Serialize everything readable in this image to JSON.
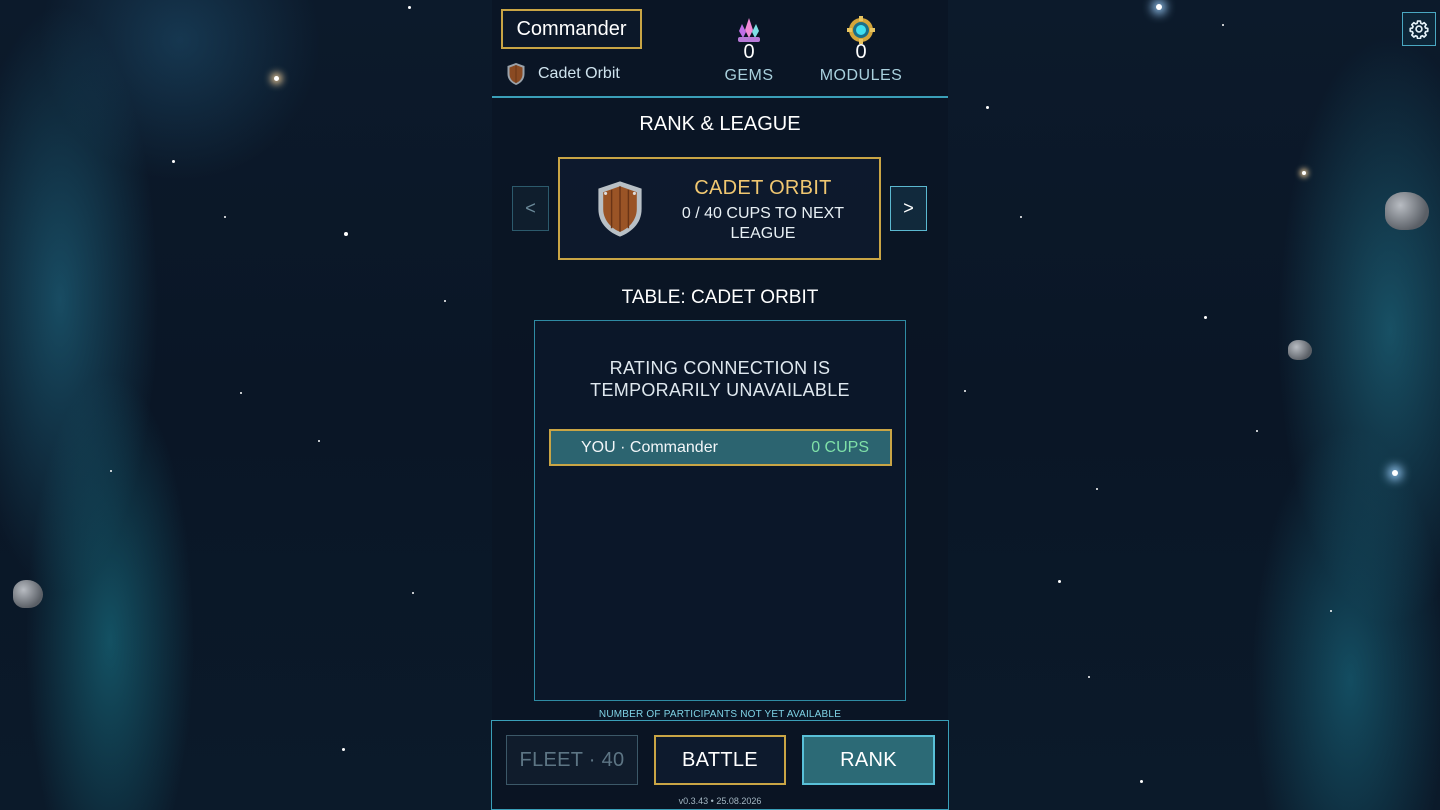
{
  "player": {
    "name": "Commander",
    "league": "Cadet Orbit"
  },
  "resources": {
    "gems": {
      "count": "0",
      "label": "GEMS",
      "icon": "gem-crystal-icon"
    },
    "modules": {
      "count": "0",
      "label": "MODULES",
      "icon": "module-icon"
    }
  },
  "rank_page": {
    "title": "RANK & LEAGUE",
    "prev_label": "<",
    "next_label": ">",
    "league_card": {
      "name": "CADET ORBIT",
      "progress": "0 / 40 CUPS TO NEXT LEAGUE",
      "icon": "wooden-shield-icon"
    },
    "table_title": "TABLE: CADET ORBIT",
    "table_message": "RATING CONNECTION IS TEMPORARILY UNAVAILABLE",
    "you_row": {
      "name": "YOU · Commander",
      "cups": "0 CUPS"
    },
    "participants_note": "NUMBER OF PARTICIPANTS NOT YET AVAILABLE"
  },
  "bottom_nav": {
    "fleet_label": "FLEET · 40",
    "battle_label": "BATTLE",
    "rank_label": "RANK",
    "version": "v0.3.43 • 25.08.2026"
  },
  "settings": {
    "icon": "gear-icon"
  },
  "colors": {
    "accent_gold": "#c9a545",
    "accent_cyan": "#3a9fb8",
    "league_title": "#f0c771",
    "cups_green": "#7fe0a8"
  }
}
